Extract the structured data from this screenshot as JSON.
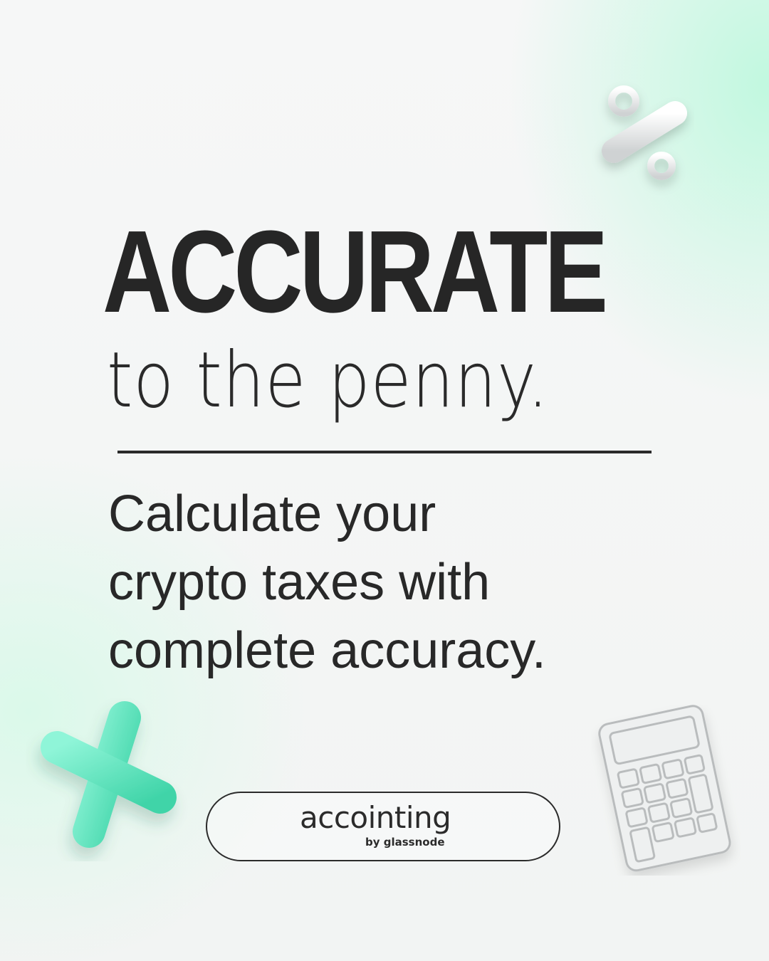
{
  "headline": "ACCURATE",
  "subheadline": "to the penny.",
  "body_lines": [
    "Calculate your",
    "crypto taxes with",
    "complete accuracy."
  ],
  "logo": {
    "wordmark": "accointing",
    "tagline": "by glassnode"
  },
  "icons": {
    "percent": "percent-icon",
    "plus": "plus-icon",
    "calculator": "calculator-icon"
  },
  "colors": {
    "text": "#262626",
    "accent_mint": "#5fe6c0",
    "background_mint": "#bef8de"
  }
}
